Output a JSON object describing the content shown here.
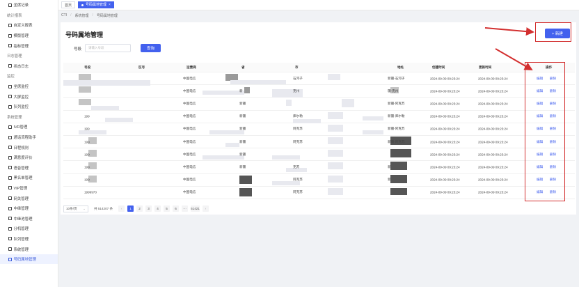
{
  "sidebar": [
    {
      "label": "坐席记录",
      "kind": "sub"
    },
    {
      "label": "统计报表",
      "kind": "group"
    },
    {
      "label": "自定义报表",
      "kind": "sub"
    },
    {
      "label": "模版管理",
      "kind": "sub"
    },
    {
      "label": "指标管理",
      "kind": "sub"
    },
    {
      "label": "日志管理",
      "kind": "group"
    },
    {
      "label": "状态日志",
      "kind": "sub"
    },
    {
      "label": "监控",
      "kind": "group"
    },
    {
      "label": "坐席监控",
      "kind": "sub"
    },
    {
      "label": "大屏监控",
      "kind": "sub"
    },
    {
      "label": "队列监控",
      "kind": "sub"
    },
    {
      "label": "系统管理",
      "kind": "group"
    },
    {
      "label": "IVR管理",
      "kind": "sub"
    },
    {
      "label": "通话流程助手",
      "kind": "sub"
    },
    {
      "label": "日程规则",
      "kind": "sub"
    },
    {
      "label": "满意度评价",
      "kind": "sub"
    },
    {
      "label": "语音管理",
      "kind": "sub"
    },
    {
      "label": "黑名单管理",
      "kind": "sub"
    },
    {
      "label": "VIP管理",
      "kind": "sub"
    },
    {
      "label": "网关管理",
      "kind": "sub"
    },
    {
      "label": "中继管理",
      "kind": "sub"
    },
    {
      "label": "中继池管理",
      "kind": "sub"
    },
    {
      "label": "分机管理",
      "kind": "sub"
    },
    {
      "label": "队列管理",
      "kind": "sub"
    },
    {
      "label": "系统管理",
      "kind": "sub"
    },
    {
      "label": "号码属地管理",
      "kind": "sub",
      "active": true
    }
  ],
  "tabs": {
    "home": "首页",
    "active": "号码属地管理",
    "close": "×"
  },
  "breadcrumb": [
    "CTI",
    "系统管理",
    "号码属地管理"
  ],
  "page": {
    "title": "号码属地管理",
    "new_button": "+ 新建",
    "search_label": "号段",
    "search_placeholder": "请输入号段",
    "query_button": "查询"
  },
  "table": {
    "headers": [
      "号段",
      "区号",
      "运营商",
      "省",
      "市",
      "地址",
      "创建时间",
      "更新时间",
      "操作"
    ],
    "rows": [
      {
        "seg": "",
        "area": "",
        "carrier": "中国电信",
        "prov": "",
        "city": "石河子",
        "addr": "新疆-石河子",
        "created": "2024-09-09 09:23:24",
        "updated": "2024-09-09 09:23:24",
        "edit": "编辑",
        "del": "删除"
      },
      {
        "seg": "",
        "area": "",
        "carrier": "中国电信",
        "prov": "新",
        "city": "克州",
        "addr": "疆-克州",
        "created": "2024-09-09 09:23:24",
        "updated": "2024-09-09 09:23:24",
        "edit": "编辑",
        "del": "删除"
      },
      {
        "seg": "",
        "area": "",
        "carrier": "中国电信",
        "prov": "新疆",
        "city": "",
        "addr": "新疆-阿克苏",
        "created": "2024-09-09 09:23:24",
        "updated": "2024-09-09 09:23:24",
        "edit": "编辑",
        "del": "删除"
      },
      {
        "seg": "199",
        "area": "",
        "carrier": "中国电信",
        "prov": "新疆",
        "city": "库尔勒",
        "addr": "新疆-库尔勒",
        "created": "2024-09-09 09:23:24",
        "updated": "2024-09-09 09:23:24",
        "edit": "编辑",
        "del": "删除"
      },
      {
        "seg": "199",
        "area": "",
        "carrier": "中国电信",
        "prov": "新疆",
        "city": "阿克苏",
        "addr": "新疆-阿克苏",
        "created": "2024-09-09 09:23:24",
        "updated": "2024-09-09 09:23:24",
        "edit": "编辑",
        "del": "删除"
      },
      {
        "seg": "199",
        "area": "",
        "carrier": "中国电信",
        "prov": "新疆",
        "city": "阿克苏",
        "addr": "新疆-阿克苏",
        "created": "2024-09-09 09:23:24",
        "updated": "2024-09-09 09:23:24",
        "edit": "编辑",
        "del": "删除"
      },
      {
        "seg": "199",
        "area": "",
        "carrier": "中国电信",
        "prov": "新疆",
        "city": "",
        "addr": "",
        "created": "2024-09-09 09:23:24",
        "updated": "2024-09-09 09:23:24",
        "edit": "编辑",
        "del": "删除"
      },
      {
        "seg": "199",
        "area": "",
        "carrier": "中国电信",
        "prov": "新疆",
        "city": "克苏",
        "addr": "新",
        "created": "2024-09-09 09:23:24",
        "updated": "2024-09-09 09:23:24",
        "edit": "编辑",
        "del": "删除"
      },
      {
        "seg": "199",
        "area": "",
        "carrier": "中国电信",
        "prov": "",
        "city": "阿克苏",
        "addr": "新",
        "created": "2024-09-09 09:23:24",
        "updated": "2024-09-09 09:23:24",
        "edit": "编辑",
        "del": "删除"
      },
      {
        "seg": "1999970",
        "area": "",
        "carrier": "中国电信",
        "prov": "",
        "city": "阿克苏",
        "addr": "",
        "created": "2024-09-09 09:23:24",
        "updated": "2024-09-09 09:23:24",
        "edit": "编辑",
        "del": "删除"
      }
    ]
  },
  "pager": {
    "size": "10条/页",
    "total": "共 514207 条",
    "pages": [
      "1",
      "2",
      "3",
      "4",
      "5",
      "6",
      "···",
      "51421"
    ],
    "prev": "‹",
    "next": "›"
  },
  "colors": {
    "accent": "#4361ee",
    "annotation": "#d32f2f"
  }
}
